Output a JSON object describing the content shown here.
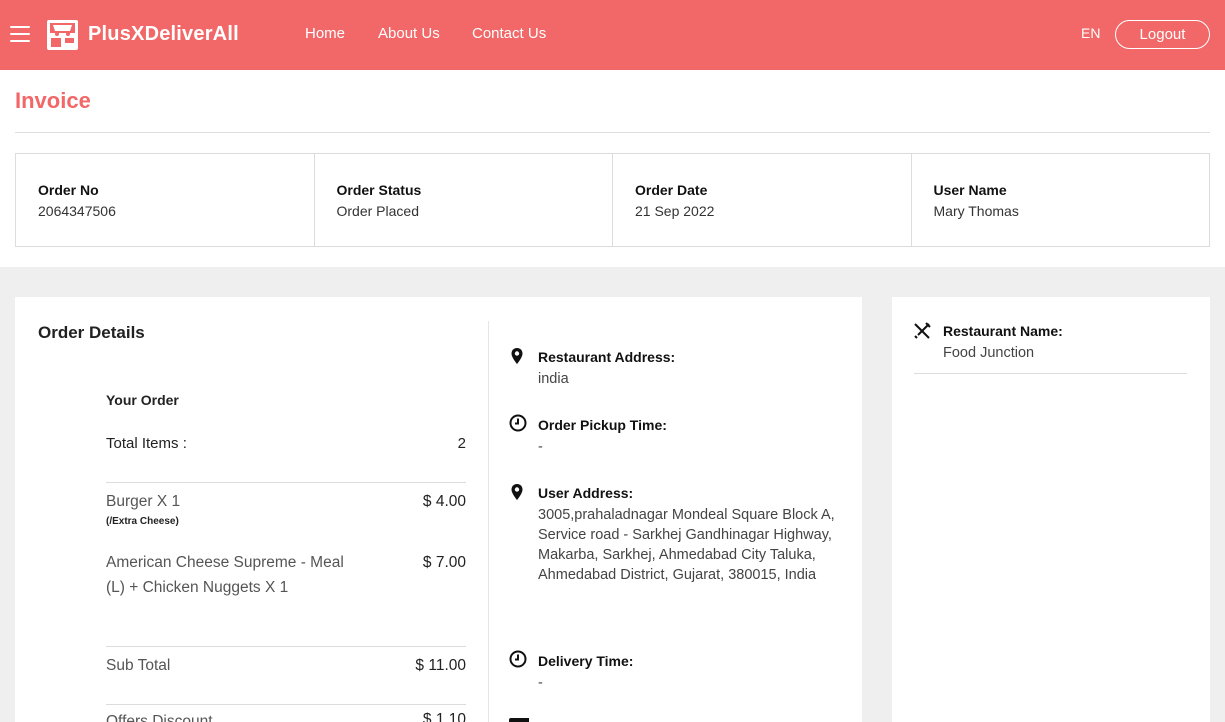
{
  "header": {
    "brand": "PlusXDeliverAll",
    "nav": [
      "Home",
      "About Us",
      "Contact Us"
    ],
    "language": "EN",
    "logout_label": "Logout"
  },
  "page": {
    "title": "Invoice"
  },
  "summary": {
    "order_no_label": "Order No",
    "order_no": "2064347506",
    "status_label": "Order Status",
    "status": "Order Placed",
    "date_label": "Order Date",
    "date": "21 Sep 2022",
    "user_label": "User Name",
    "user": "Mary Thomas"
  },
  "order_details": {
    "title": "Order Details",
    "your_order": "Your Order",
    "total_items_label": "Total Items :",
    "total_items": "2",
    "items": [
      {
        "name": "Burger X 1",
        "note": "(/Extra Cheese)",
        "price": "$ 4.00"
      },
      {
        "name": "American Cheese Supreme - Meal (L) + Chicken Nuggets X 1",
        "note": "",
        "price": "$ 7.00"
      }
    ],
    "subtotal_label": "Sub Total",
    "subtotal": "$ 11.00",
    "discount_label": "Offers Discount",
    "discount": "$ 1.10"
  },
  "delivery_info": {
    "restaurant_address_label": "Restaurant Address:",
    "restaurant_address": "india",
    "pickup_time_label": "Order Pickup Time:",
    "pickup_time": "-",
    "user_address_label": "User Address:",
    "user_address": "3005,prahaladnagar Mondeal Square Block A, Service road - Sarkhej Gandhinagar Highway, Makarba, Sarkhej, Ahmedabad City Taluka, Ahmedabad District, Gujarat, 380015, India",
    "delivery_time_label": "Delivery Time:",
    "delivery_time": "-"
  },
  "restaurant": {
    "name_label": "Restaurant Name:",
    "name": "Food Junction"
  },
  "icons": {
    "menu": "hamburger-menu-icon",
    "logo": "store-logo-icon",
    "restaurant_address": "map-pin-icon",
    "pickup_time": "clock-icon",
    "user_address": "map-pin-icon",
    "delivery_time": "clock-icon",
    "restaurant_name": "fork-knife-icon"
  },
  "colors": {
    "brand": "#f26767",
    "background_gray": "#efefef"
  }
}
